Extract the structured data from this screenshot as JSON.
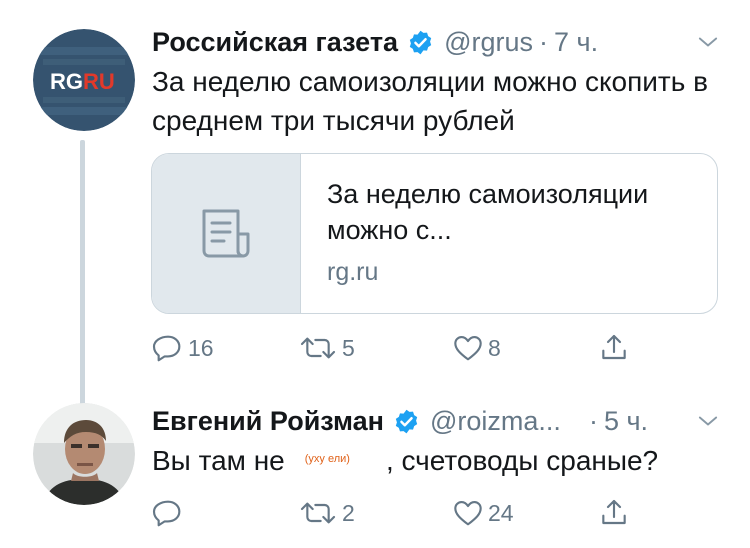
{
  "tweets": [
    {
      "author_name": "Российская газета",
      "handle": "@rgrus",
      "separator": "·",
      "time": "7 ч.",
      "avatar_text": "RG",
      "avatar_text2": "RU",
      "text": "За неделю самоизоляции можно скопить в среднем три тысячи рублей",
      "card": {
        "title": "За неделю самоизоляции можно с...",
        "domain": "rg.ru"
      },
      "actions": {
        "replies": "16",
        "retweets": "5",
        "likes": "8"
      }
    },
    {
      "author_name": "Евгений Ройзман",
      "handle": "@roizma...",
      "separator": "·",
      "time": "5 ч.",
      "text_before": "Вы там не",
      "censored": "(уху ели)",
      "text_after": ", счетоводы сраные?",
      "actions": {
        "replies": "",
        "retweets": "2",
        "likes": "24"
      }
    }
  ],
  "icons": {
    "verified": "verified-badge-icon",
    "caret": "chevron-down-icon",
    "reply": "reply-icon",
    "retweet": "retweet-icon",
    "like": "heart-icon",
    "share": "share-icon",
    "card_placeholder": "document-icon"
  },
  "colors": {
    "verified": "#1da1f2",
    "secondary_text": "#657786",
    "censored_text": "#e0621a",
    "avatar_bg": "#35536f",
    "avatar_red": "#e2392a"
  }
}
